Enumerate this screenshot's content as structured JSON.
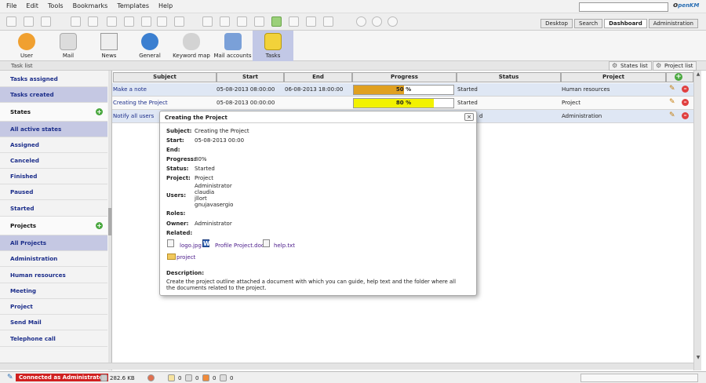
{
  "menu": [
    "File",
    "Edit",
    "Tools",
    "Bookmarks",
    "Templates",
    "Help"
  ],
  "logo": {
    "main": "penKM",
    "prefix": "o"
  },
  "top_tabs": [
    "Desktop",
    "Search",
    "Dashboard",
    "Administration"
  ],
  "active_top_tab": "Dashboard",
  "sections": [
    {
      "label": "User",
      "icon": "user-icon",
      "color": "#f0a030"
    },
    {
      "label": "Mail",
      "icon": "mail-icon",
      "color": "#d8d8d8"
    },
    {
      "label": "News",
      "icon": "news-icon",
      "color": "#e8e8e8"
    },
    {
      "label": "General",
      "icon": "globe-icon",
      "color": "#3b7fd0"
    },
    {
      "label": "Keyword map",
      "icon": "cloud-icon",
      "color": "#cfcfcf"
    },
    {
      "label": "Mail accounts",
      "icon": "mail-accounts-icon",
      "color": "#7aa0d8"
    },
    {
      "label": "Tasks",
      "icon": "tasks-icon",
      "color": "#f2d23a"
    }
  ],
  "subheader": {
    "title": "Task list",
    "states_btn": "States list",
    "project_btn": "Project list"
  },
  "left_panel": {
    "items": [
      {
        "label": "Tasks assigned",
        "type": "item"
      },
      {
        "label": "Tasks created",
        "type": "selected"
      },
      {
        "label": "States",
        "type": "header"
      },
      {
        "label": "All active states",
        "type": "selected"
      },
      {
        "label": "Assigned",
        "type": "item"
      },
      {
        "label": "Canceled",
        "type": "item"
      },
      {
        "label": "Finished",
        "type": "item"
      },
      {
        "label": "Paused",
        "type": "item"
      },
      {
        "label": "Started",
        "type": "item"
      },
      {
        "label": "Projects",
        "type": "header"
      },
      {
        "label": "All Projects",
        "type": "selected"
      },
      {
        "label": "Administration",
        "type": "item"
      },
      {
        "label": "Human resources",
        "type": "item"
      },
      {
        "label": "Meeting",
        "type": "item"
      },
      {
        "label": "Project",
        "type": "item"
      },
      {
        "label": "Send Mail",
        "type": "item"
      },
      {
        "label": "Telephone call",
        "type": "item"
      }
    ]
  },
  "table": {
    "columns": [
      "Subject",
      "Start",
      "End",
      "Progress",
      "Status",
      "Project"
    ],
    "rows": [
      {
        "subject": "Make a note",
        "start": "05-08-2013 08:00:00",
        "end": "06-08-2013 18:00:00",
        "progress": 50,
        "progress_label": "50  %",
        "progress_color": "#e0a020",
        "status": "Started",
        "project": "Human resources"
      },
      {
        "subject": "Creating the Project",
        "start": "05-08-2013 00:00:00",
        "end": "",
        "progress": 80,
        "progress_label": "80  %",
        "progress_color": "#f2f200",
        "status": "Started",
        "project": "Project"
      },
      {
        "subject": "Notify all users",
        "start": "",
        "end": "",
        "progress": 0,
        "progress_label": "",
        "progress_color": "#ffffff",
        "status": "d",
        "project": "Administration"
      }
    ]
  },
  "popup": {
    "title": "Creating the Project",
    "fields": [
      {
        "label": "Subject:",
        "value": "Creating the Project"
      },
      {
        "label": "Start:",
        "value": "05-08-2013 00:00"
      },
      {
        "label": "End:",
        "value": ""
      },
      {
        "label": "Progress:",
        "value": "80%"
      },
      {
        "label": "Status:",
        "value": "Started"
      },
      {
        "label": "Project:",
        "value": "Project"
      }
    ],
    "users_label": "Users:",
    "users": [
      "Administrator",
      "claudia",
      "jllort",
      "gnujavasergio"
    ],
    "roles_label": "Roles:",
    "owner_label": "Owner:",
    "owner": "Administrator",
    "related_label": "Related:",
    "docs": [
      "logo.jpg",
      "Profile Project.doc",
      "help.txt"
    ],
    "folder": "project",
    "description_label": "Description:",
    "description": "Create the project outline attached a document with which you can guide, help text and the folder where all the documents related to the project."
  },
  "status": {
    "connected": "Connected as Administrator",
    "size": "282.6 KB",
    "count1": "0",
    "count2": "0",
    "count3": "0",
    "count4": "0"
  }
}
